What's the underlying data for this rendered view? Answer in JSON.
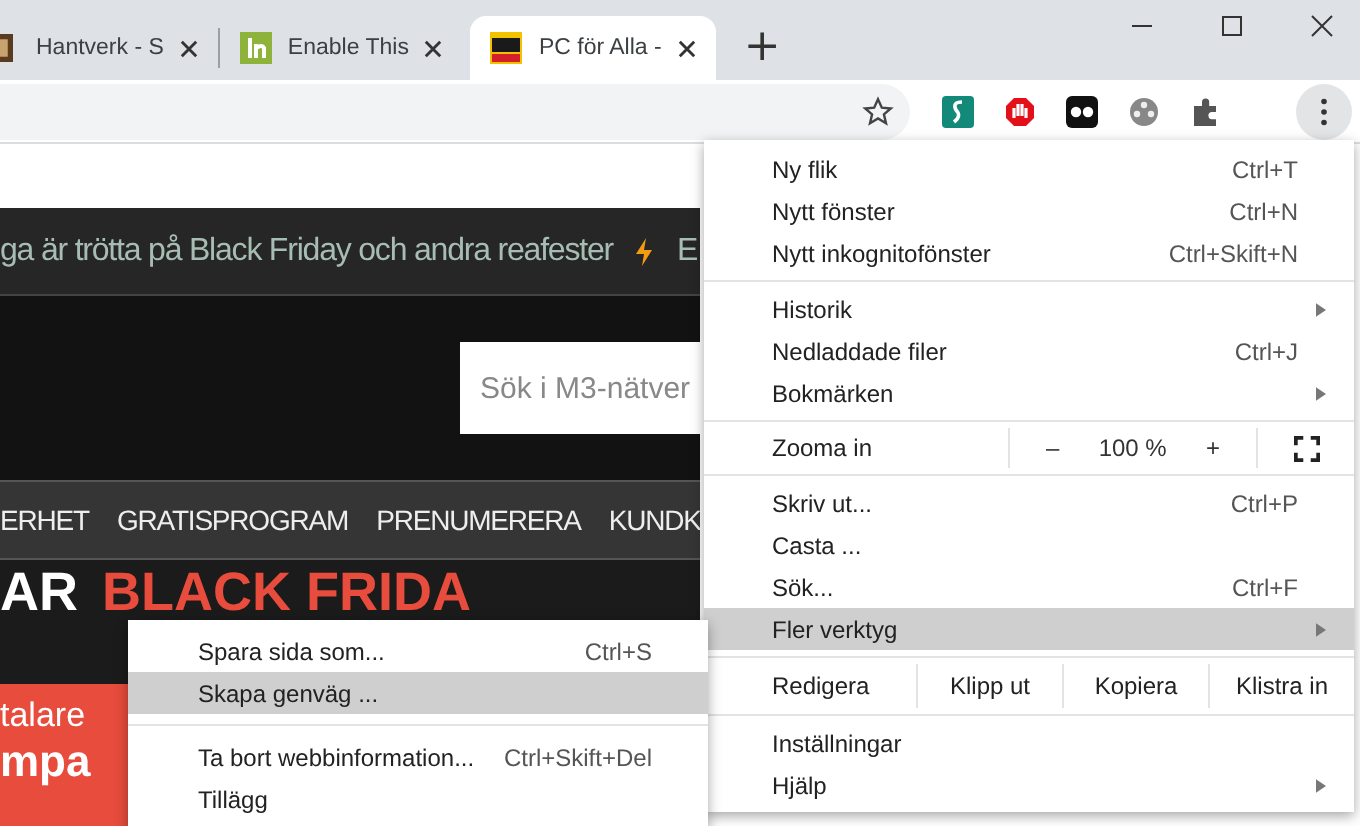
{
  "tabs": [
    {
      "title": "Hantverk - S",
      "selected": false
    },
    {
      "title": "Enable This",
      "selected": false
    },
    {
      "title": "PC för Alla -",
      "selected": true
    }
  ],
  "new_tab": "+",
  "page": {
    "ticker": "ga är trötta på Black Friday och andra reafester",
    "ticker_next": "E",
    "search": {
      "placeholder": "Sök i M3-nätver"
    },
    "nav": [
      "ERHET",
      "GRATISPROGRAM",
      "PRENUMERERA",
      "KUNDK"
    ],
    "hero": {
      "headline_1": "AR",
      "headline_2": "BLACK FRIDA",
      "label": "talare",
      "sub": "mpa"
    }
  },
  "menu": {
    "sections": [
      {
        "items": [
          {
            "kind": "item",
            "label": "Ny flik",
            "shortcut": "Ctrl+T",
            "has_submenu": false,
            "selected": false
          },
          {
            "kind": "item",
            "label": "Nytt fönster",
            "shortcut": "Ctrl+N",
            "has_submenu": false,
            "selected": false
          },
          {
            "kind": "item",
            "label": "Nytt inkognitofönster",
            "shortcut": "Ctrl+Skift+N",
            "has_submenu": false,
            "selected": false
          }
        ]
      },
      {
        "items": [
          {
            "kind": "item",
            "label": "Historik",
            "has_submenu": true,
            "selected": false
          },
          {
            "kind": "item",
            "label": "Nedladdade filer",
            "shortcut": "Ctrl+J",
            "has_submenu": false,
            "selected": false
          },
          {
            "kind": "item",
            "label": "Bokmärken",
            "has_submenu": true,
            "selected": false
          }
        ]
      },
      {
        "items": [
          {
            "kind": "zoom",
            "label": "Zooma in",
            "minus": "–",
            "value": "100 %",
            "plus": "+"
          }
        ]
      },
      {
        "items": [
          {
            "kind": "item",
            "label": "Skriv ut...",
            "shortcut": "Ctrl+P",
            "has_submenu": false,
            "selected": false
          },
          {
            "kind": "item",
            "label": "Casta ...",
            "has_submenu": false,
            "selected": false
          },
          {
            "kind": "item",
            "label": "Sök...",
            "shortcut": "Ctrl+F",
            "has_submenu": false,
            "selected": false
          },
          {
            "kind": "item",
            "label": "Fler verktyg",
            "has_submenu": true,
            "selected": true
          }
        ]
      },
      {
        "items": [
          {
            "kind": "edit",
            "label": "Redigera",
            "actions": [
              "Klipp ut",
              "Kopiera",
              "Klistra in"
            ]
          }
        ]
      },
      {
        "items": [
          {
            "kind": "item",
            "label": "Inställningar",
            "has_submenu": false,
            "selected": false
          },
          {
            "kind": "item",
            "label": "Hjälp",
            "has_submenu": true,
            "selected": false
          }
        ]
      }
    ]
  },
  "submenu": {
    "sections": [
      {
        "items": [
          {
            "label": "Spara sida som...",
            "shortcut": "Ctrl+S",
            "selected": false
          },
          {
            "label": "Skapa genväg ...",
            "selected": true
          }
        ]
      },
      {
        "items": [
          {
            "label": "Ta bort webbinformation...",
            "shortcut": "Ctrl+Skift+Del",
            "selected": false
          },
          {
            "label": "Tillägg",
            "selected": false
          }
        ]
      }
    ]
  }
}
